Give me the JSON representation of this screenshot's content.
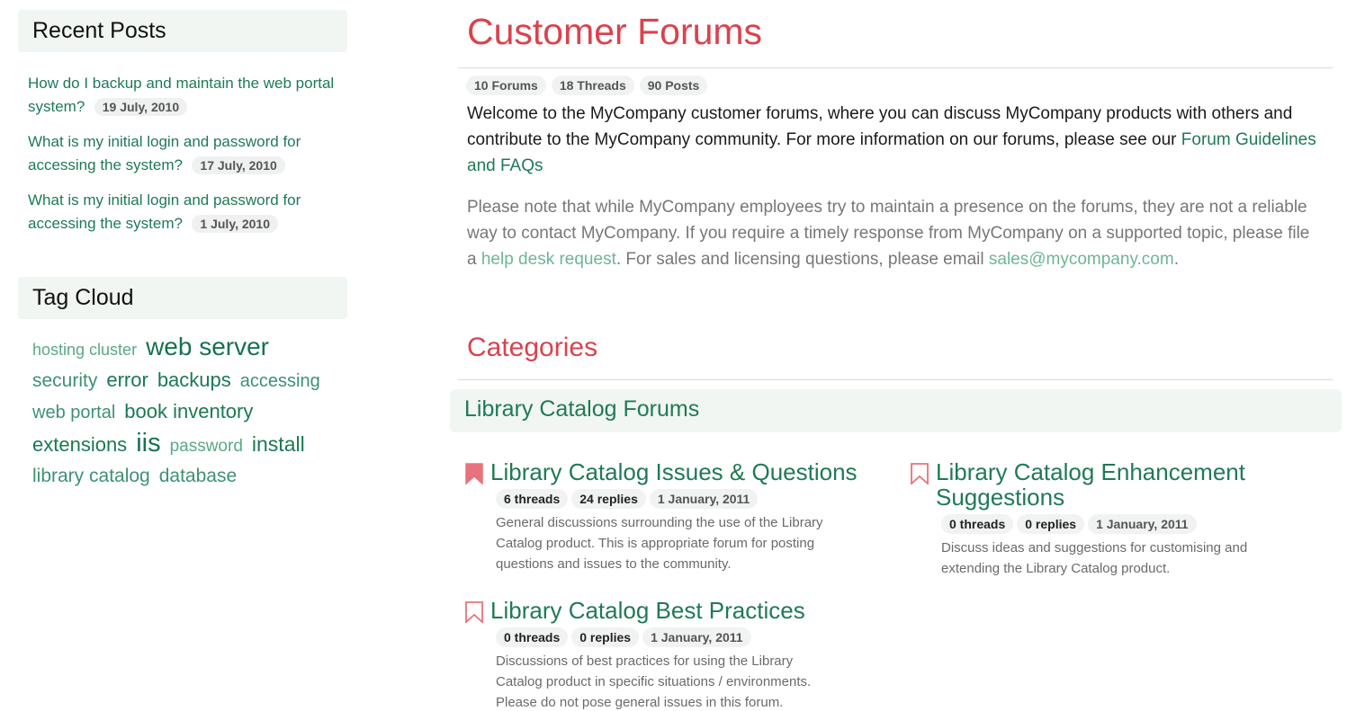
{
  "sidebar": {
    "recent_title": "Recent Posts",
    "recent_posts": [
      {
        "title": "How do I backup and maintain the web portal system?",
        "date": "19 July, 2010"
      },
      {
        "title": "What is my initial login and password for accessing the system?",
        "date": "17 July, 2010"
      },
      {
        "title": "What is my initial login and password for accessing the system?",
        "date": "1 July, 2010"
      }
    ],
    "tag_title": "Tag Cloud",
    "tags": [
      "hosting cluster",
      "web server",
      "security",
      "error",
      "backups",
      "accessing",
      "web portal",
      "book inventory",
      "extensions",
      "iis",
      "password",
      "install",
      "library catalog",
      "database"
    ]
  },
  "main": {
    "title": "Customer Forums",
    "stats": {
      "forums": "10 Forums",
      "threads": "18 Threads",
      "posts": "90 Posts"
    },
    "intro_text": "Welcome to the MyCompany customer forums, where you can discuss MyCompany products with others and contribute to the MyCompany community. For more information on our forums, please see our",
    "intro_link": "Forum Guidelines and FAQs",
    "note_part1": "Please note that while MyCompany employees try to maintain a presence on the forums, they are not a reliable way to contact MyCompany. If you require a timely response from MyCompany on a supported topic, please file a",
    "note_link1": "help desk request",
    "note_part2": ". For sales and licensing questions, please email",
    "note_link2": "sales@mycompany.com",
    "note_end": ".",
    "categories_title": "Categories",
    "group_title": "Library Catalog Forums",
    "forums": [
      {
        "title": "Library Catalog Issues & Questions",
        "threads": "6 threads",
        "replies": "24 replies",
        "date": "1 January, 2011",
        "desc": "General discussions surrounding the use of the Library Catalog product. This is appropriate forum for posting questions and issues to the community."
      },
      {
        "title": "Library Catalog Enhancement Suggestions",
        "threads": "0 threads",
        "replies": "0 replies",
        "date": "1 January, 2011",
        "desc": "Discuss ideas and suggestions for customising and extending the Library Catalog product."
      },
      {
        "title": "Library Catalog Best Practices",
        "threads": "0 threads",
        "replies": "0 replies",
        "date": "1 January, 2011",
        "desc": "Discussions of best practices for using the Library Catalog product in specific situations / environments. Please do not pose general issues in this forum."
      }
    ]
  },
  "colors": {
    "accent_red": "#d9434d",
    "link_green": "#1f7a55",
    "bookmark": "#e8737c"
  }
}
